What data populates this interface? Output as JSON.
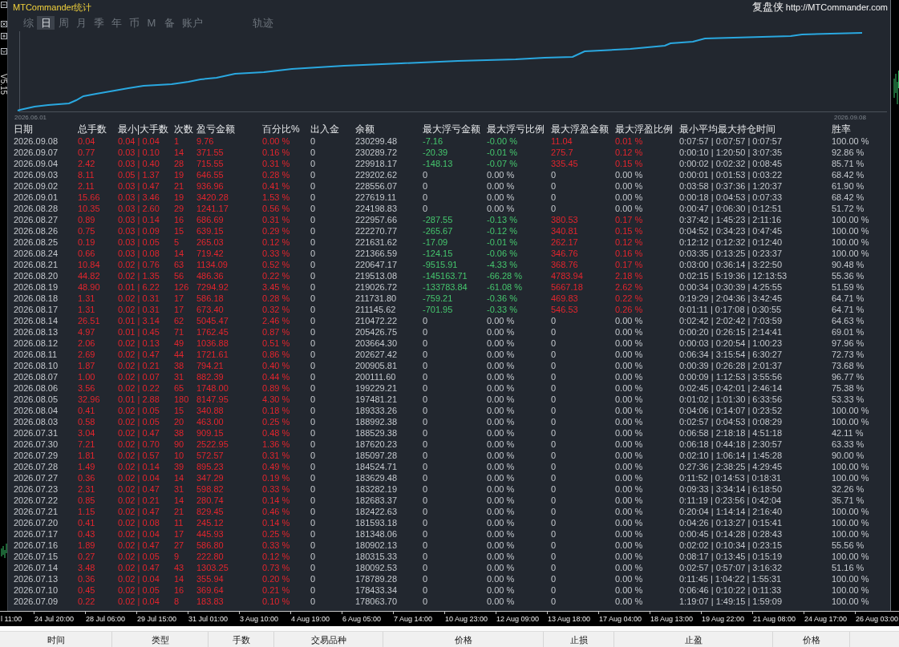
{
  "window": {
    "title": "MTCommander统计",
    "brand": "复盘侠",
    "url": "http://MTCommander.com",
    "version": "V5.15"
  },
  "tabs": [
    {
      "label": "综",
      "selected": false
    },
    {
      "label": "日",
      "selected": true
    },
    {
      "label": "周",
      "selected": false
    },
    {
      "label": "月",
      "selected": false
    },
    {
      "label": "季",
      "selected": false
    },
    {
      "label": "年",
      "selected": false
    },
    {
      "label": "币",
      "selected": false
    },
    {
      "label": "M",
      "selected": false
    },
    {
      "label": "备",
      "selected": false
    },
    {
      "label": "账户",
      "selected": false
    }
  ],
  "side_tabs": [
    {
      "label": "轨迹",
      "selected": false
    }
  ],
  "chart": {
    "start_label": "2026.06.01",
    "end_label": "2026.09.08"
  },
  "table": {
    "columns": [
      {
        "label": "日期",
        "kind": "plain"
      },
      {
        "label": "总手数",
        "kind": "gain"
      },
      {
        "label": "最小|大手数",
        "kind": "gain"
      },
      {
        "label": "次数",
        "kind": "gain"
      },
      {
        "label": "盈亏金额",
        "kind": "gain"
      },
      {
        "label": "百分比%",
        "kind": "gain"
      },
      {
        "label": "出入金",
        "kind": "plain"
      },
      {
        "label": "余额",
        "kind": "plain"
      },
      {
        "label": "最大浮亏金额",
        "kind": "float_loss"
      },
      {
        "label": "最大浮亏比例",
        "kind": "float_loss"
      },
      {
        "label": "最大浮盈金额",
        "kind": "float_gain"
      },
      {
        "label": "最大浮盈比例",
        "kind": "float_gain"
      },
      {
        "label": "最小平均最大持仓时间",
        "kind": "plain"
      },
      {
        "label": "胜率",
        "kind": "plain"
      }
    ],
    "rows": [
      {
        "kind": "float",
        "cells": [
          "2026.09.08",
          "0.04",
          "0.04 | 0.04",
          "1",
          "9.76",
          "0.00 %",
          "0",
          "230299.48",
          "-7.16",
          "-0.00 %",
          "11.04",
          "0.01 %",
          "0:07:57 | 0:07:57 | 0:07:57",
          "100.00 %"
        ]
      },
      {
        "kind": "float",
        "cells": [
          "2026.09.07",
          "0.77",
          "0.03 | 0.10",
          "14",
          "371.55",
          "0.16 %",
          "0",
          "230289.72",
          "-20.39",
          "-0.01 %",
          "275.7",
          "0.12 %",
          "0:00:10 | 1:20:50 | 3:07:35",
          "92.86 %"
        ]
      },
      {
        "kind": "float",
        "cells": [
          "2026.09.04",
          "2.42",
          "0.03 | 0.40",
          "28",
          "715.55",
          "0.31 %",
          "0",
          "229918.17",
          "-148.13",
          "-0.07 %",
          "335.45",
          "0.15 %",
          "0:00:02 | 0:02:32 | 0:08:45",
          "85.71 %"
        ]
      },
      {
        "kind": "flat",
        "cells": [
          "2026.09.03",
          "8.11",
          "0.05 | 1.37",
          "19",
          "646.55",
          "0.28 %",
          "0",
          "229202.62",
          "0",
          "0.00 %",
          "0",
          "0.00 %",
          "0:00:01 | 0:01:53 | 0:03:22",
          "68.42 %"
        ]
      },
      {
        "kind": "flat",
        "cells": [
          "2026.09.02",
          "2.11",
          "0.03 | 0.47",
          "21",
          "936.96",
          "0.41 %",
          "0",
          "228556.07",
          "0",
          "0.00 %",
          "0",
          "0.00 %",
          "0:03:58 | 0:37:36 | 1:20:37",
          "61.90 %"
        ]
      },
      {
        "kind": "flat",
        "cells": [
          "2026.09.01",
          "15.66",
          "0.03 | 3.46",
          "19",
          "3420.28",
          "1.53 %",
          "0",
          "227619.11",
          "0",
          "0.00 %",
          "0",
          "0.00 %",
          "0:00:18 | 0:04:53 | 0:07:33",
          "68.42 %"
        ]
      },
      {
        "kind": "flat",
        "cells": [
          "2026.08.28",
          "10.35",
          "0.03 | 2.60",
          "29",
          "1241.17",
          "0.56 %",
          "0",
          "224198.83",
          "0",
          "0.00 %",
          "0",
          "0.00 %",
          "0:00:47 | 0:06:30 | 0:12:51",
          "51.72 %"
        ]
      },
      {
        "kind": "float",
        "cells": [
          "2026.08.27",
          "0.89",
          "0.03 | 0.14",
          "16",
          "686.69",
          "0.31 %",
          "0",
          "222957.66",
          "-287.55",
          "-0.13 %",
          "380.53",
          "0.17 %",
          "0:37:42 | 1:45:23 | 2:11:16",
          "100.00 %"
        ]
      },
      {
        "kind": "float",
        "cells": [
          "2026.08.26",
          "0.75",
          "0.03 | 0.09",
          "15",
          "639.15",
          "0.29 %",
          "0",
          "222270.77",
          "-265.67",
          "-0.12 %",
          "340.81",
          "0.15 %",
          "0:04:52 | 0:34:23 | 0:47:45",
          "100.00 %"
        ]
      },
      {
        "kind": "float",
        "cells": [
          "2026.08.25",
          "0.19",
          "0.03 | 0.05",
          "5",
          "265.03",
          "0.12 %",
          "0",
          "221631.62",
          "-17.09",
          "-0.01 %",
          "262.17",
          "0.12 %",
          "0:12:12 | 0:12:32 | 0:12:40",
          "100.00 %"
        ]
      },
      {
        "kind": "float",
        "cells": [
          "2026.08.24",
          "0.66",
          "0.03 | 0.08",
          "14",
          "719.42",
          "0.33 %",
          "0",
          "221366.59",
          "-124.15",
          "-0.06 %",
          "346.76",
          "0.16 %",
          "0:03:35 | 0:13:25 | 0:23:37",
          "100.00 %"
        ]
      },
      {
        "kind": "float",
        "cells": [
          "2026.08.21",
          "10.84",
          "0.02 | 0.76",
          "63",
          "1134.09",
          "0.52 %",
          "0",
          "220647.17",
          "-9515.91",
          "-4.33 %",
          "368.76",
          "0.17 %",
          "0:03:00 | 0:36:14 | 3:22:50",
          "90.48 %"
        ]
      },
      {
        "kind": "float",
        "cells": [
          "2026.08.20",
          "44.82",
          "0.02 | 1.35",
          "56",
          "486.36",
          "0.22 %",
          "0",
          "219513.08",
          "-145163.71",
          "-66.28 %",
          "4783.94",
          "2.18 %",
          "0:02:15 | 5:19:36 | 12:13:53",
          "55.36 %"
        ]
      },
      {
        "kind": "float",
        "cells": [
          "2026.08.19",
          "48.90",
          "0.01 | 6.22",
          "126",
          "7294.92",
          "3.45 %",
          "0",
          "219026.72",
          "-133783.84",
          "-61.08 %",
          "5667.18",
          "2.62 %",
          "0:00:34 | 0:30:39 | 4:25:55",
          "51.59 %"
        ]
      },
      {
        "kind": "float",
        "cells": [
          "2026.08.18",
          "1.31",
          "0.02 | 0.31",
          "17",
          "586.18",
          "0.28 %",
          "0",
          "211731.80",
          "-759.21",
          "-0.36 %",
          "469.83",
          "0.22 %",
          "0:19:29 | 2:04:36 | 3:42:45",
          "64.71 %"
        ]
      },
      {
        "kind": "float",
        "cells": [
          "2026.08.17",
          "1.31",
          "0.02 | 0.31",
          "17",
          "673.40",
          "0.32 %",
          "0",
          "211145.62",
          "-701.95",
          "-0.33 %",
          "546.53",
          "0.26 %",
          "0:01:11 | 0:17:08 | 0:30:55",
          "64.71 %"
        ]
      },
      {
        "kind": "flat",
        "cells": [
          "2026.08.14",
          "26.51",
          "0.01 | 3.14",
          "62",
          "5045.47",
          "2.46 %",
          "0",
          "210472.22",
          "0",
          "0.00 %",
          "0",
          "0.00 %",
          "0:02:42 | 2:02:42 | 7:03:59",
          "64.63 %"
        ]
      },
      {
        "kind": "flat",
        "cells": [
          "2026.08.13",
          "4.97",
          "0.01 | 0.45",
          "71",
          "1762.45",
          "0.87 %",
          "0",
          "205426.75",
          "0",
          "0.00 %",
          "0",
          "0.00 %",
          "0:00:20 | 0:26:15 | 2:14:41",
          "69.01 %"
        ]
      },
      {
        "kind": "flat",
        "cells": [
          "2026.08.12",
          "2.06",
          "0.02 | 0.13",
          "49",
          "1036.88",
          "0.51 %",
          "0",
          "203664.30",
          "0",
          "0.00 %",
          "0",
          "0.00 %",
          "0:00:03 | 0:20:54 | 1:00:23",
          "97.96 %"
        ]
      },
      {
        "kind": "flat",
        "cells": [
          "2026.08.11",
          "2.69",
          "0.02 | 0.47",
          "44",
          "1721.61",
          "0.86 %",
          "0",
          "202627.42",
          "0",
          "0.00 %",
          "0",
          "0.00 %",
          "0:06:34 | 3:15:54 | 6:30:27",
          "72.73 %"
        ]
      },
      {
        "kind": "flat",
        "cells": [
          "2026.08.10",
          "1.87",
          "0.02 | 0.21",
          "38",
          "794.21",
          "0.40 %",
          "0",
          "200905.81",
          "0",
          "0.00 %",
          "0",
          "0.00 %",
          "0:00:39 | 0:26:28 | 2:01:37",
          "73.68 %"
        ]
      },
      {
        "kind": "flat",
        "cells": [
          "2026.08.07",
          "1.00",
          "0.02 | 0.07",
          "31",
          "882.39",
          "0.44 %",
          "0",
          "200111.60",
          "0",
          "0.00 %",
          "0",
          "0.00 %",
          "0:00:09 | 1:12:53 | 3:55:56",
          "96.77 %"
        ]
      },
      {
        "kind": "flat",
        "cells": [
          "2026.08.06",
          "3.56",
          "0.02 | 0.22",
          "65",
          "1748.00",
          "0.89 %",
          "0",
          "199229.21",
          "0",
          "0.00 %",
          "0",
          "0.00 %",
          "0:02:45 | 0:42:01 | 2:46:14",
          "75.38 %"
        ]
      },
      {
        "kind": "flat",
        "cells": [
          "2026.08.05",
          "32.96",
          "0.01 | 2.88",
          "180",
          "8147.95",
          "4.30 %",
          "0",
          "197481.21",
          "0",
          "0.00 %",
          "0",
          "0.00 %",
          "0:01:02 | 1:01:30 | 6:33:56",
          "53.33 %"
        ]
      },
      {
        "kind": "flat",
        "cells": [
          "2026.08.04",
          "0.41",
          "0.02 | 0.05",
          "15",
          "340.88",
          "0.18 %",
          "0",
          "189333.26",
          "0",
          "0.00 %",
          "0",
          "0.00 %",
          "0:04:06 | 0:14:07 | 0:23:52",
          "100.00 %"
        ]
      },
      {
        "kind": "flat",
        "cells": [
          "2026.08.03",
          "0.58",
          "0.02 | 0.05",
          "20",
          "463.00",
          "0.25 %",
          "0",
          "188992.38",
          "0",
          "0.00 %",
          "0",
          "0.00 %",
          "0:02:57 | 0:04:53 | 0:08:29",
          "100.00 %"
        ]
      },
      {
        "kind": "flat",
        "cells": [
          "2026.07.31",
          "3.04",
          "0.02 | 0.47",
          "38",
          "909.15",
          "0.48 %",
          "0",
          "188529.38",
          "0",
          "0.00 %",
          "0",
          "0.00 %",
          "0:06:58 | 2:18:18 | 4:51:18",
          "42.11 %"
        ]
      },
      {
        "kind": "flat",
        "cells": [
          "2026.07.30",
          "7.21",
          "0.02 | 0.70",
          "90",
          "2522.95",
          "1.36 %",
          "0",
          "187620.23",
          "0",
          "0.00 %",
          "0",
          "0.00 %",
          "0:06:18 | 0:44:18 | 2:30:57",
          "63.33 %"
        ]
      },
      {
        "kind": "flat",
        "cells": [
          "2026.07.29",
          "1.81",
          "0.02 | 0.57",
          "10",
          "572.57",
          "0.31 %",
          "0",
          "185097.28",
          "0",
          "0.00 %",
          "0",
          "0.00 %",
          "0:02:10 | 1:06:14 | 1:45:28",
          "90.00 %"
        ]
      },
      {
        "kind": "flat",
        "cells": [
          "2026.07.28",
          "1.49",
          "0.02 | 0.14",
          "39",
          "895.23",
          "0.49 %",
          "0",
          "184524.71",
          "0",
          "0.00 %",
          "0",
          "0.00 %",
          "0:27:36 | 2:38:25 | 4:29:45",
          "100.00 %"
        ]
      },
      {
        "kind": "flat",
        "cells": [
          "2026.07.27",
          "0.36",
          "0.02 | 0.04",
          "14",
          "347.29",
          "0.19 %",
          "0",
          "183629.48",
          "0",
          "0.00 %",
          "0",
          "0.00 %",
          "0:11:52 | 0:14:53 | 0:18:31",
          "100.00 %"
        ]
      },
      {
        "kind": "flat",
        "cells": [
          "2026.07.23",
          "2.31",
          "0.02 | 0.47",
          "31",
          "598.82",
          "0.33 %",
          "0",
          "183282.19",
          "0",
          "0.00 %",
          "0",
          "0.00 %",
          "0:09:33 | 3:34:14 | 6:18:50",
          "32.26 %"
        ]
      },
      {
        "kind": "flat",
        "cells": [
          "2026.07.22",
          "0.85",
          "0.02 | 0.21",
          "14",
          "280.74",
          "0.14 %",
          "0",
          "182683.37",
          "0",
          "0.00 %",
          "0",
          "0.00 %",
          "0:11:19 | 0:23:56 | 0:42:04",
          "35.71 %"
        ]
      },
      {
        "kind": "flat",
        "cells": [
          "2026.07.21",
          "1.15",
          "0.02 | 0.47",
          "21",
          "829.45",
          "0.46 %",
          "0",
          "182422.63",
          "0",
          "0.00 %",
          "0",
          "0.00 %",
          "0:20:04 | 1:14:14 | 2:16:40",
          "100.00 %"
        ]
      },
      {
        "kind": "flat",
        "cells": [
          "2026.07.20",
          "0.41",
          "0.02 | 0.08",
          "11",
          "245.12",
          "0.14 %",
          "0",
          "181593.18",
          "0",
          "0.00 %",
          "0",
          "0.00 %",
          "0:04:26 | 0:13:27 | 0:15:41",
          "100.00 %"
        ]
      },
      {
        "kind": "flat",
        "cells": [
          "2026.07.17",
          "0.43",
          "0.02 | 0.04",
          "17",
          "445.93",
          "0.25 %",
          "0",
          "181348.06",
          "0",
          "0.00 %",
          "0",
          "0.00 %",
          "0:00:45 | 0:14:28 | 0:28:43",
          "100.00 %"
        ]
      },
      {
        "kind": "flat",
        "cells": [
          "2026.07.16",
          "1.89",
          "0.02 | 0.47",
          "27",
          "586.80",
          "0.33 %",
          "0",
          "180902.13",
          "0",
          "0.00 %",
          "0",
          "0.00 %",
          "0:02:02 | 0:10:34 | 0:23:15",
          "55.56 %"
        ]
      },
      {
        "kind": "flat",
        "cells": [
          "2026.07.15",
          "0.27",
          "0.02 | 0.05",
          "9",
          "222.80",
          "0.12 %",
          "0",
          "180315.33",
          "0",
          "0.00 %",
          "0",
          "0.00 %",
          "0:08:17 | 0:13:45 | 0:15:19",
          "100.00 %"
        ]
      },
      {
        "kind": "flat",
        "cells": [
          "2026.07.14",
          "3.48",
          "0.02 | 0.47",
          "43",
          "1303.25",
          "0.73 %",
          "0",
          "180092.53",
          "0",
          "0.00 %",
          "0",
          "0.00 %",
          "0:02:57 | 0:57:07 | 3:16:32",
          "51.16 %"
        ]
      },
      {
        "kind": "flat",
        "cells": [
          "2026.07.13",
          "0.36",
          "0.02 | 0.04",
          "14",
          "355.94",
          "0.20 %",
          "0",
          "178789.28",
          "0",
          "0.00 %",
          "0",
          "0.00 %",
          "0:11:45 | 1:04:22 | 1:55:31",
          "100.00 %"
        ]
      },
      {
        "kind": "flat",
        "cells": [
          "2026.07.10",
          "0.45",
          "0.02 | 0.05",
          "16",
          "369.64",
          "0.21 %",
          "0",
          "178433.34",
          "0",
          "0.00 %",
          "0",
          "0.00 %",
          "0:06:46 | 0:10:22 | 0:11:33",
          "100.00 %"
        ]
      },
      {
        "kind": "flat",
        "cells": [
          "2026.07.09",
          "0.22",
          "0.02 | 0.04",
          "8",
          "183.83",
          "0.10 %",
          "0",
          "178063.70",
          "0",
          "0.00 %",
          "0",
          "0.00 %",
          "1:19:07 | 1:49:15 | 1:59:09",
          "100.00 %"
        ]
      }
    ]
  },
  "time_axis": [
    "l 11:00",
    "24 Jul 20:00",
    "28 Jul 06:00",
    "29 Jul 15:00",
    "31 Jul 01:00",
    "3 Aug 10:00",
    "4 Aug 19:00",
    "6 Aug 05:00",
    "7 Aug 14:00",
    "10 Aug 23:00",
    "12 Aug 09:00",
    "13 Aug 18:00",
    "17 Aug 04:00",
    "18 Aug 13:00",
    "19 Aug 22:00",
    "21 Aug 08:00",
    "24 Aug 17:00",
    "26 Aug 03:00"
  ],
  "terminal_columns": [
    "时间",
    "类型",
    "手数",
    "交易品种",
    "价格",
    "止损",
    "止盈",
    "价格"
  ]
}
